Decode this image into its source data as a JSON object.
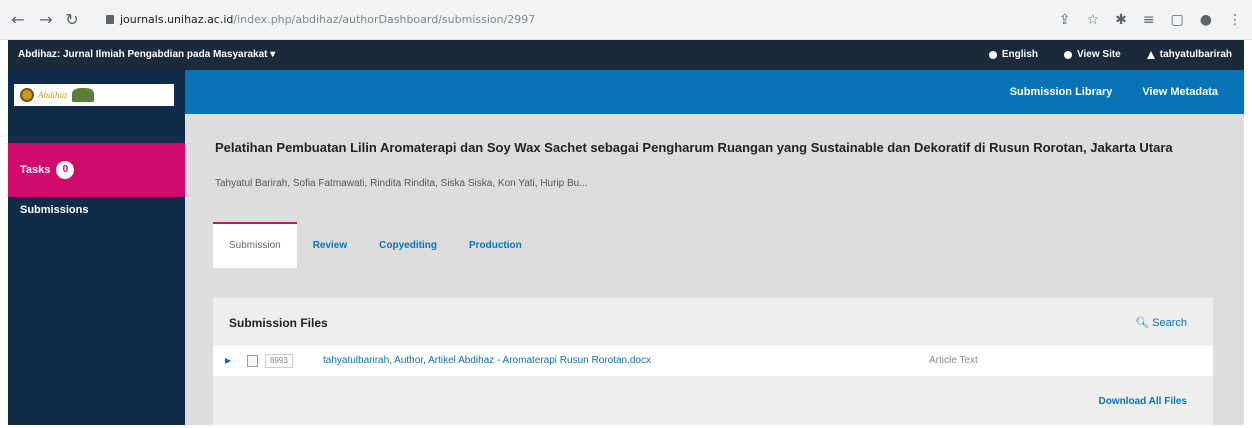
{
  "browser": {
    "url_host": "journals.unihaz.ac.id",
    "url_path": "/index.php/abdihaz/authorDashboard/submission/2997"
  },
  "site_bar": {
    "context": "Abdihaz: Jurnal Ilmiah Pengabdian pada Masyarakat ▾",
    "language": "English",
    "view_site": "View Site",
    "user": "tahyatulbarirah"
  },
  "sidebar": {
    "logo_text": "Abdihaz",
    "tasks_label": "Tasks",
    "tasks_count": "0",
    "submissions_label": "Submissions"
  },
  "header": {
    "submission_library": "Submission Library",
    "view_metadata": "View Metadata"
  },
  "submission": {
    "title": "Pelatihan Pembuatan Lilin Aromaterapi dan Soy Wax Sachet sebagai Pengharum Ruangan yang Sustainable dan Dekoratif di Rusun Rorotan, Jakarta Utara",
    "authors": "Tahyatul Barirah, Sofia Fatmawati, Rindita Rindita, Siska Siska, Kon Yati, Hurip Bu..."
  },
  "tabs": [
    {
      "label": "Submission",
      "active": true
    },
    {
      "label": "Review",
      "active": false
    },
    {
      "label": "Copyediting",
      "active": false
    },
    {
      "label": "Production",
      "active": false
    }
  ],
  "files_panel": {
    "title": "Submission Files",
    "search": "Search",
    "file_id": "8993",
    "file_name": "tahyatulbarirah, Author, Artikel Abdihaz - Aromaterapi Rusun Rorotan.docx",
    "file_type": "Article Text",
    "download_all": "Download All Files"
  },
  "colors": {
    "sidebar": "#0f2d4a",
    "accent_pink": "#d00a6c",
    "accent_blue": "#0874b8"
  }
}
